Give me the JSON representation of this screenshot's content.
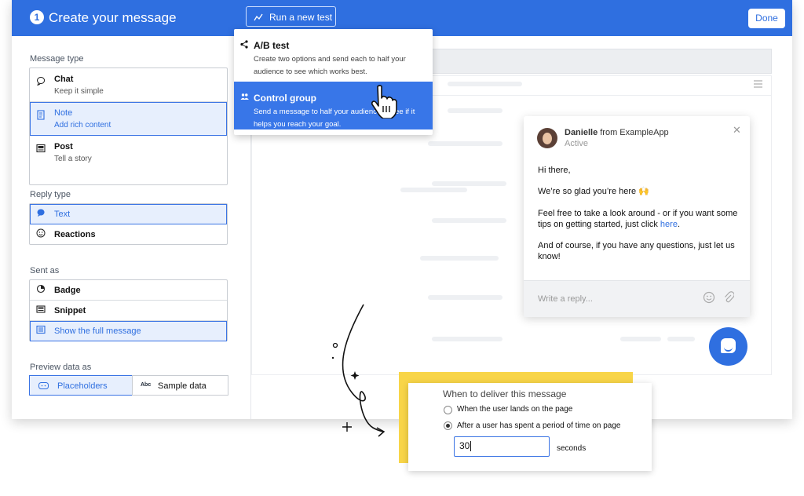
{
  "header": {
    "step": "1",
    "title": "Create your message",
    "run_test_label": "Run a new test",
    "done_label": "Done"
  },
  "sidebar": {
    "message_type_label": "Message type",
    "message_types": [
      {
        "title": "Chat",
        "subtitle": "Keep it simple",
        "icon": "speech-bubble-icon",
        "selected": false
      },
      {
        "title": "Note",
        "subtitle": "Add rich content",
        "icon": "note-icon",
        "selected": true
      },
      {
        "title": "Post",
        "subtitle": "Tell a story",
        "icon": "post-icon",
        "selected": false
      }
    ],
    "reply_type_label": "Reply type",
    "reply_types": [
      {
        "title": "Text",
        "icon": "speech-bubble-icon",
        "selected": true
      },
      {
        "title": "Reactions",
        "icon": "smiley-icon",
        "selected": false
      }
    ],
    "sent_as_label": "Sent as",
    "sent_as": [
      {
        "title": "Badge",
        "icon": "badge-icon",
        "selected": false
      },
      {
        "title": "Snippet",
        "icon": "snippet-icon",
        "selected": false
      },
      {
        "title": "Show the full message",
        "icon": "full-message-icon",
        "selected": true
      }
    ],
    "preview_label": "Preview data as",
    "preview_options": [
      {
        "title": "Placeholders",
        "selected": true
      },
      {
        "title": "Sample data",
        "icon_text": "Abc",
        "selected": false
      }
    ]
  },
  "test_menu": {
    "items": [
      {
        "title": "A/B test",
        "description": "Create two options and send each to half your audience to see which works best.",
        "icon": "share-icon",
        "active": false
      },
      {
        "title": "Control group",
        "description": "Send a message to half your audience to see if it helps you reach your goal.",
        "icon": "group-icon",
        "active": true
      }
    ]
  },
  "chat": {
    "sender_name": "Danielle",
    "sender_from": "from ExampleApp",
    "status": "Active",
    "greeting": "Hi there,",
    "line1": "We’re so glad you’re here 🙌",
    "line2_prefix": "Feel free to take a look around - or if you want some tips on getting started, just click ",
    "line2_link": "here",
    "line2_suffix": ".",
    "line3": "And of course, if you have any questions, just let us know!",
    "reply_placeholder": "Write a reply..."
  },
  "delivery": {
    "title": "When to deliver this message",
    "options": [
      {
        "label": "When the user lands on the page",
        "checked": false
      },
      {
        "label": "After a user has spent a period of time on page",
        "checked": true
      }
    ],
    "input_value": "30",
    "unit": "seconds"
  },
  "colors": {
    "primary": "#2f6fe0",
    "selected_bg": "#e7effd",
    "highlight_yellow": "#f8d548"
  }
}
